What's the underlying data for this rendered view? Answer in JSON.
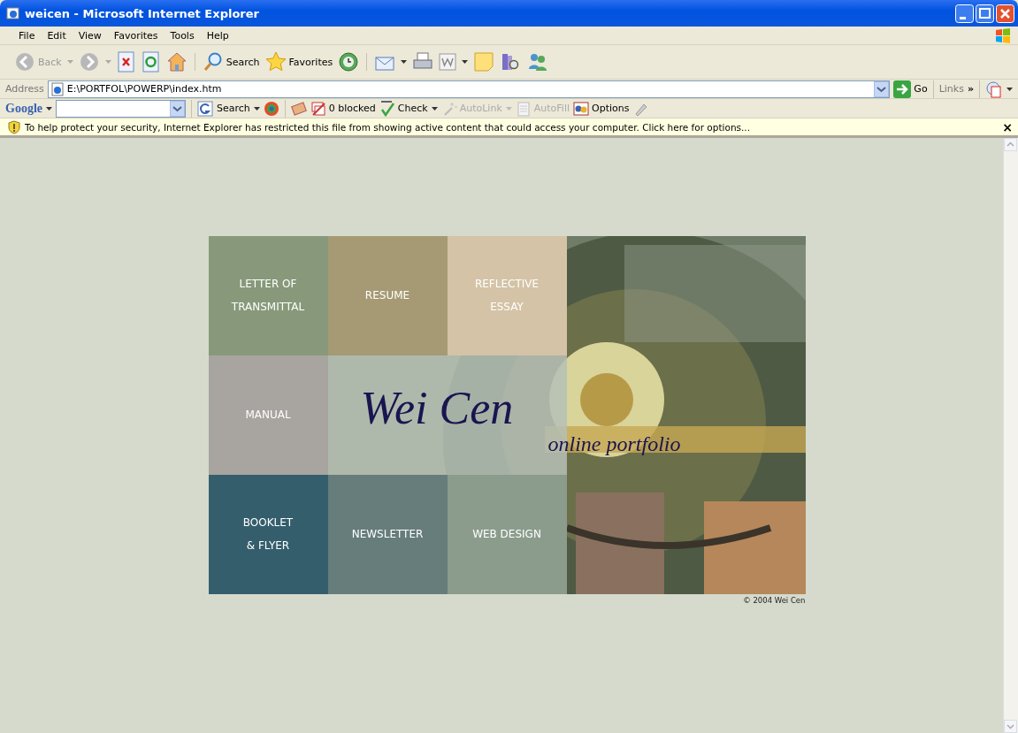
{
  "window": {
    "title": "weicen - Microsoft Internet Explorer"
  },
  "menu": [
    "File",
    "Edit",
    "View",
    "Favorites",
    "Tools",
    "Help"
  ],
  "toolbar": {
    "back": "Back",
    "search": "Search",
    "favorites": "Favorites"
  },
  "address": {
    "label": "Address",
    "value": "E:\\PORTFOL\\POWERP\\index.htm",
    "go": "Go",
    "links": "Links",
    "more": "»"
  },
  "google_bar": {
    "logo": "Google",
    "items": [
      {
        "label": "Search",
        "disabled": false
      },
      {
        "label": "0 blocked",
        "disabled": false
      },
      {
        "label": "Check",
        "disabled": false
      },
      {
        "label": "AutoLink",
        "disabled": true
      },
      {
        "label": "AutoFill",
        "disabled": true
      },
      {
        "label": "Options",
        "disabled": false
      }
    ]
  },
  "info_bar": {
    "text": "To help protect your security, Internet Explorer has restricted this file from showing active content that could access your computer. Click here for options...",
    "close": "×"
  },
  "page": {
    "tiles": [
      {
        "lines": [
          "LETTER OF",
          "TRANSMITTAL"
        ],
        "color": "#87997a"
      },
      {
        "lines": [
          "RESUME"
        ],
        "color": "#a59a74"
      },
      {
        "lines": [
          "REFLECTIVE",
          "ESSAY"
        ],
        "color": "#d4c3a6"
      },
      {
        "lines": [
          "MANUAL"
        ],
        "color": "#a8a49f"
      },
      {
        "color": "#b6c1b6"
      },
      {
        "color": "#b6c1b6"
      },
      {
        "lines": [
          "BOOKLET",
          "& FLYER"
        ],
        "color": "#355e6d"
      },
      {
        "lines": [
          "NEWSLETTER"
        ],
        "color": "#667d7b"
      },
      {
        "lines": [
          "WEB DESIGN"
        ],
        "color": "#8b9c8c"
      }
    ],
    "title": "Wei Cen",
    "subtitle": "online portfolio",
    "copyright": "© 2004 Wei Cen"
  }
}
